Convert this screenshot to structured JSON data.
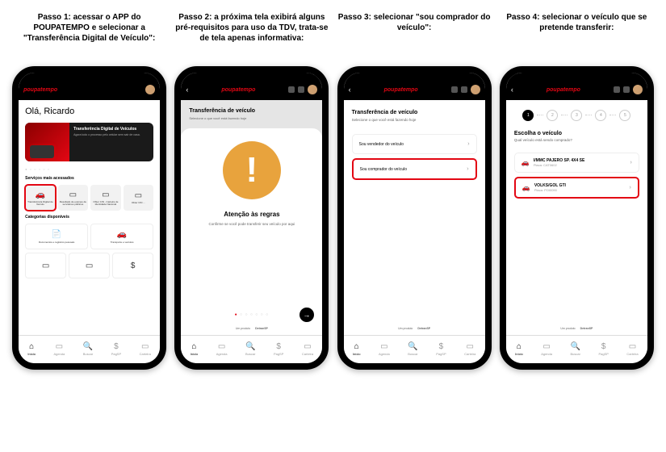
{
  "steps": {
    "s1": "Passo 1: acessar o APP do POUPATEMPO e selecionar a \"Transferência Digital de Veículo\":",
    "s2": "Passo 2: a próxima tela exibirá alguns pré-requisitos para uso da TDV, trata-se de tela apenas informativa:",
    "s3": "Passo 3: selecionar \"sou comprador do veículo\":",
    "s4": "Passo 4: selecionar o veículo que se pretende transferir:"
  },
  "app": {
    "logo": "poupatempo"
  },
  "screen1": {
    "greeting": "Olá, Ricardo",
    "promo_title": "Transferência Digital de Veículos",
    "promo_sub": "Agora todo o processo pelo celular sem sair de casa.",
    "section_services": "Serviços mais acessados",
    "services": [
      {
        "icon": "🚗",
        "label": "Transferência Digital de Veículo"
      },
      {
        "icon": "▭",
        "label": "Resultado de exames de servidores públicos"
      },
      {
        "icon": "▭",
        "label": "Obter CIN - Carteira de Identidade Nacional"
      },
      {
        "icon": "▭",
        "label": "Obter CIN ..."
      }
    ],
    "section_categories": "Categorias disponíveis",
    "categories": [
      {
        "icon": "📄",
        "label": "Documentos e registros pessoais"
      },
      {
        "icon": "🚗",
        "label": "Transporte e veículos"
      },
      {
        "icon": "▭",
        "label": ""
      },
      {
        "icon": "▭",
        "label": ""
      },
      {
        "icon": "$",
        "label": ""
      }
    ]
  },
  "screen2": {
    "title": "Transferência de veículo",
    "sub": "Selecione o que você está fazendo hoje",
    "modal_title": "Atenção às regras",
    "modal_sub": "Confirme se você pode transferir seu veículo por aqui"
  },
  "screen3": {
    "title": "Transferência de veículo",
    "sub": "Selecione o que você está fazendo hoje",
    "opt_seller": "Sou vendedor do veículo",
    "opt_buyer": "Sou comprador do veículo"
  },
  "screen4": {
    "stepper": [
      "1",
      "2",
      "3",
      "4",
      "5"
    ],
    "heading": "Escolha o veículo",
    "sub": "Qual veículo está sendo comprado?",
    "vehicles": [
      {
        "name": "I/MMC PAJERO SP. 4X4 SE",
        "plate": "Placa: CAT0602"
      },
      {
        "name": "VOLKS/GOL GTI",
        "plate": "Placa: POI0090"
      }
    ]
  },
  "nav": {
    "items": [
      {
        "icon": "⌂",
        "label": "Início"
      },
      {
        "icon": "▭",
        "label": "Agenda"
      },
      {
        "icon": "🔍",
        "label": "Buscar"
      },
      {
        "icon": "$",
        "label": "PagSP"
      },
      {
        "icon": "▭",
        "label": "Carteira"
      }
    ]
  },
  "partner": {
    "text": "Um produto",
    "brand": "DetranSP"
  }
}
